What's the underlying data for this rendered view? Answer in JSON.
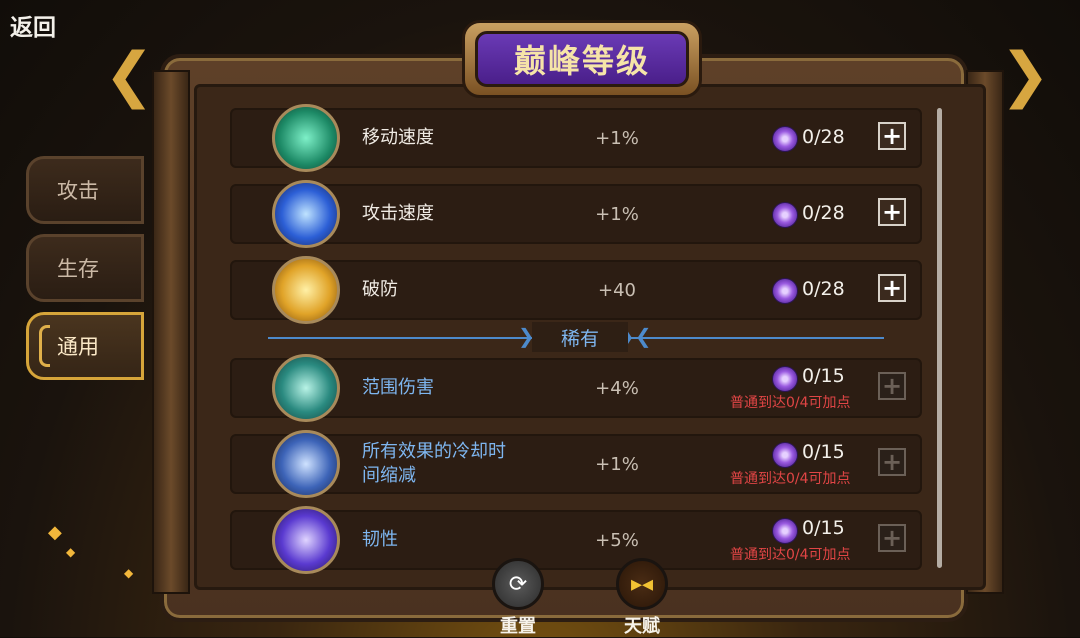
{
  "nav": {
    "back_label": "返回"
  },
  "title": "巅峰等级",
  "side_tabs": [
    {
      "label": "攻击"
    },
    {
      "label": "生存"
    },
    {
      "label": "通用"
    }
  ],
  "active_tab": "通用",
  "divider_label": "稀有",
  "rows": [
    {
      "name": "移动速度",
      "value": "+1%",
      "count": "0/28",
      "note": "",
      "plus_enabled": true
    },
    {
      "name": "攻击速度",
      "value": "+1%",
      "count": "0/28",
      "note": "",
      "plus_enabled": true
    },
    {
      "name": "破防",
      "value": "+40",
      "count": "0/28",
      "note": "",
      "plus_enabled": true
    },
    {
      "name": "范围伤害",
      "value": "+4%",
      "count": "0/15",
      "note": "普通到达0/4可加点",
      "plus_enabled": false
    },
    {
      "name": "所有效果的冷却时间缩减",
      "value": "+1%",
      "count": "0/15",
      "note": "普通到达0/4可加点",
      "plus_enabled": false
    },
    {
      "name": "韧性",
      "value": "+5%",
      "count": "0/15",
      "note": "普通到达0/4可加点",
      "plus_enabled": false
    }
  ],
  "bottom": {
    "reset_label": "重置",
    "talent_label": "天赋"
  },
  "colors": {
    "rare_blue": "#7eb6f0",
    "warning_red": "#e04545",
    "accent_gold": "#d6a53a",
    "title_purple": "#5a2aa0"
  }
}
